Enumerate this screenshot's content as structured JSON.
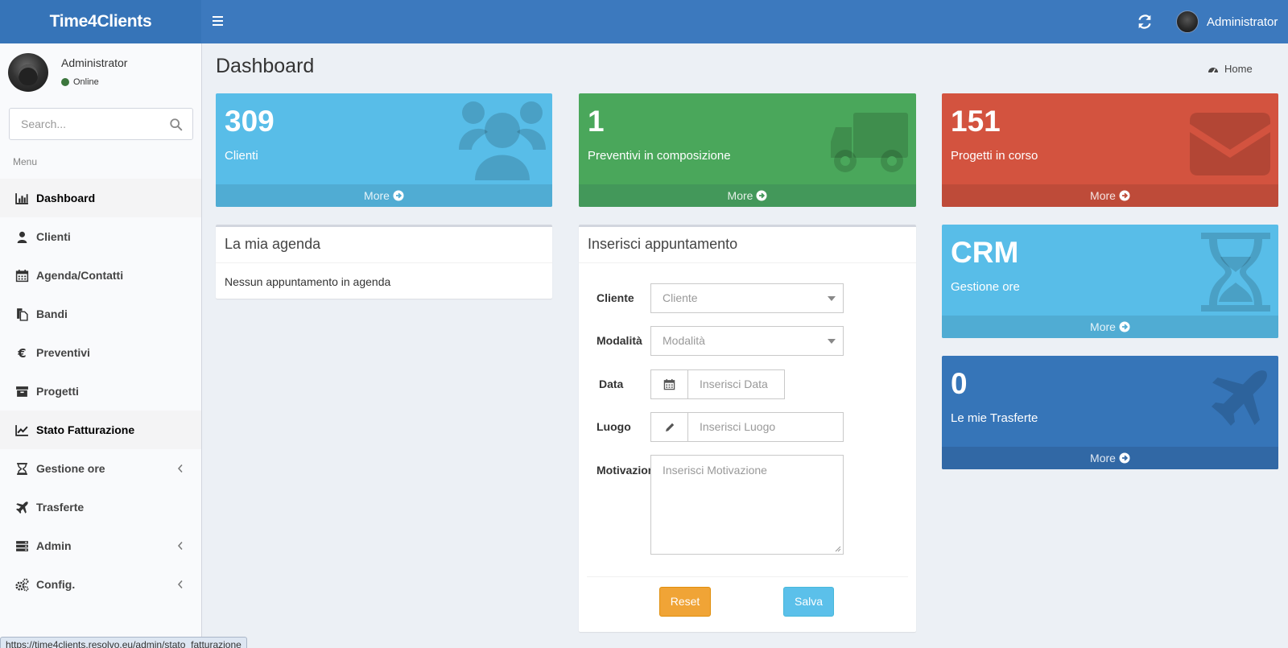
{
  "header": {
    "logo": "Time4Clients",
    "user_name": "Administrator"
  },
  "sidebar": {
    "user_name": "Administrator",
    "status": "Online",
    "search_placeholder": "Search...",
    "menu_header": "Menu",
    "items": [
      {
        "label": "Dashboard",
        "icon": "bar-chart-icon"
      },
      {
        "label": "Clienti",
        "icon": "user-icon"
      },
      {
        "label": "Agenda/Contatti",
        "icon": "calendar-icon"
      },
      {
        "label": "Bandi",
        "icon": "files-icon"
      },
      {
        "label": "Preventivi",
        "icon": "euro-icon"
      },
      {
        "label": "Progetti",
        "icon": "archive-icon"
      },
      {
        "label": "Stato Fatturazione",
        "icon": "line-chart-icon"
      },
      {
        "label": "Gestione ore",
        "icon": "hourglass-icon"
      },
      {
        "label": "Trasferte",
        "icon": "plane-icon"
      },
      {
        "label": "Admin",
        "icon": "server-icon"
      },
      {
        "label": "Config.",
        "icon": "cogs-icon"
      }
    ]
  },
  "content": {
    "title": "Dashboard",
    "breadcrumb_home": "Home"
  },
  "boxes": [
    {
      "number": "309",
      "label": "Clienti",
      "more": "More",
      "color": "#58bde8",
      "icon": "users-icon"
    },
    {
      "number": "1",
      "label": "Preventivi in composizione",
      "more": "More",
      "color": "#4aa75b",
      "icon": "truck-icon"
    },
    {
      "number": "151",
      "label": "Progetti in corso",
      "more": "More",
      "color": "#d3533f",
      "icon": "envelope-icon"
    },
    {
      "number": "CRM",
      "label": "Gestione ore",
      "more": "More",
      "color": "#58bde8",
      "icon": "hourglass-icon"
    },
    {
      "number": "0",
      "label": "Le mie Trasferte",
      "more": "More",
      "color": "#3675b8",
      "icon": "plane-icon"
    }
  ],
  "agenda": {
    "title": "La mia agenda",
    "empty": "Nessun appuntamento in agenda"
  },
  "form": {
    "title": "Inserisci appuntamento",
    "cliente_label": "Cliente",
    "cliente_placeholder": "Cliente",
    "modalita_label": "Modalità",
    "modalita_placeholder": "Modalità",
    "data_label": "Data",
    "data_placeholder": "Inserisci Data",
    "luogo_label": "Luogo",
    "luogo_placeholder": "Inserisci Luogo",
    "motivazione_label": "Motivazione",
    "motivazione_placeholder": "Inserisci Motivazione",
    "reset": "Reset",
    "save": "Salva"
  },
  "statusbar": {
    "url": "https://time4clients.resolvo.eu/admin/stato_fatturazione"
  }
}
